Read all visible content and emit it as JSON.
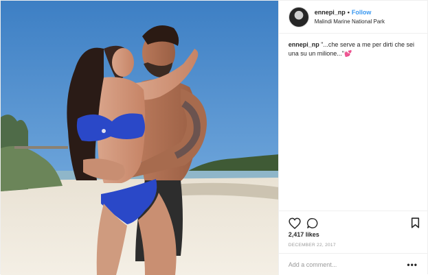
{
  "post": {
    "username": "ennepi_np",
    "separator": "•",
    "follow_label": "Follow",
    "location": "Malindi Marine National Park",
    "caption": {
      "username": "ennepi_np",
      "text": "\"...che serve a me per dirti che sei una su un milione...\"💕"
    },
    "likes": "2,417 likes",
    "date": "DECEMBER 22, 2017",
    "comment_placeholder": "Add a comment...",
    "more_label": "•••"
  },
  "icons": {
    "like": "heart-icon",
    "comment": "comment-icon",
    "save": "bookmark-icon"
  },
  "colors": {
    "follow": "#3897f0",
    "text": "#262626",
    "muted": "#999999",
    "border": "#efefef"
  }
}
